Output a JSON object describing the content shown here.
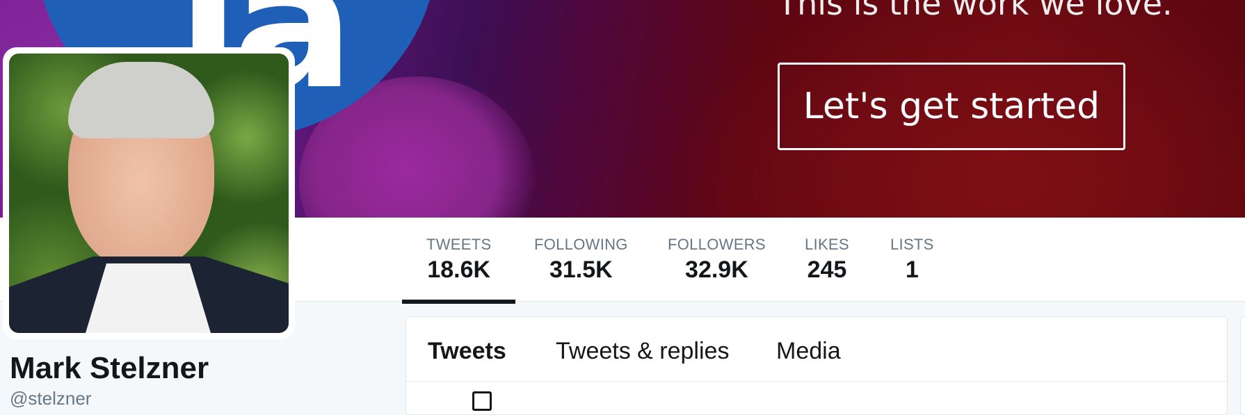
{
  "banner": {
    "logo_letters": "la",
    "tagline": "This is the work we love.",
    "cta_label": "Let's get started"
  },
  "stats": [
    {
      "label": "TWEETS",
      "value": "18.6K",
      "active": true
    },
    {
      "label": "FOLLOWING",
      "value": "31.5K"
    },
    {
      "label": "FOLLOWERS",
      "value": "32.9K"
    },
    {
      "label": "LIKES",
      "value": "245"
    },
    {
      "label": "LISTS",
      "value": "1"
    }
  ],
  "profile": {
    "name": "Mark Stelzner",
    "handle": "@stelzner"
  },
  "tabs": [
    {
      "label": "Tweets",
      "active": true
    },
    {
      "label": "Tweets & replies"
    },
    {
      "label": "Media"
    }
  ],
  "colors": {
    "accent_underline": "#14171a",
    "label_gray": "#657786",
    "text_dark": "#14171a",
    "background": "#f5f8fa"
  }
}
